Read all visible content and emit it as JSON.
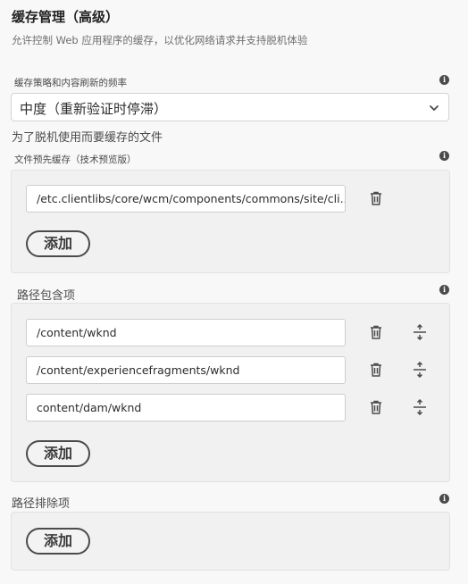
{
  "header": {
    "title": "缓存管理（高级）",
    "subtitle": "允许控制 Web 应用程序的缓存，以优化网络请求并支持脱机体验"
  },
  "cache_strategy": {
    "label": "缓存策略和内容刷新的频率",
    "selected": "中度（重新验证时停滞）"
  },
  "offline_files": {
    "heading": "为了脱机使用而要缓存的文件",
    "precache_label": "文件预先缓存（技术预览版）",
    "items": [
      "/etc.clientlibs/core/wcm/components/commons/site/cli..."
    ],
    "add_label": "添加"
  },
  "path_includes": {
    "label": "路径包含项",
    "items": [
      "/content/wknd",
      "/content/experiencefragments/wknd",
      "content/dam/wknd"
    ],
    "add_label": "添加"
  },
  "path_excludes": {
    "label": "路径排除项",
    "add_label": "添加"
  },
  "icons": {
    "info": "info-icon",
    "delete": "trash-icon",
    "reorder": "drag-handle-icon",
    "dropdown": "chevron-down-icon"
  }
}
